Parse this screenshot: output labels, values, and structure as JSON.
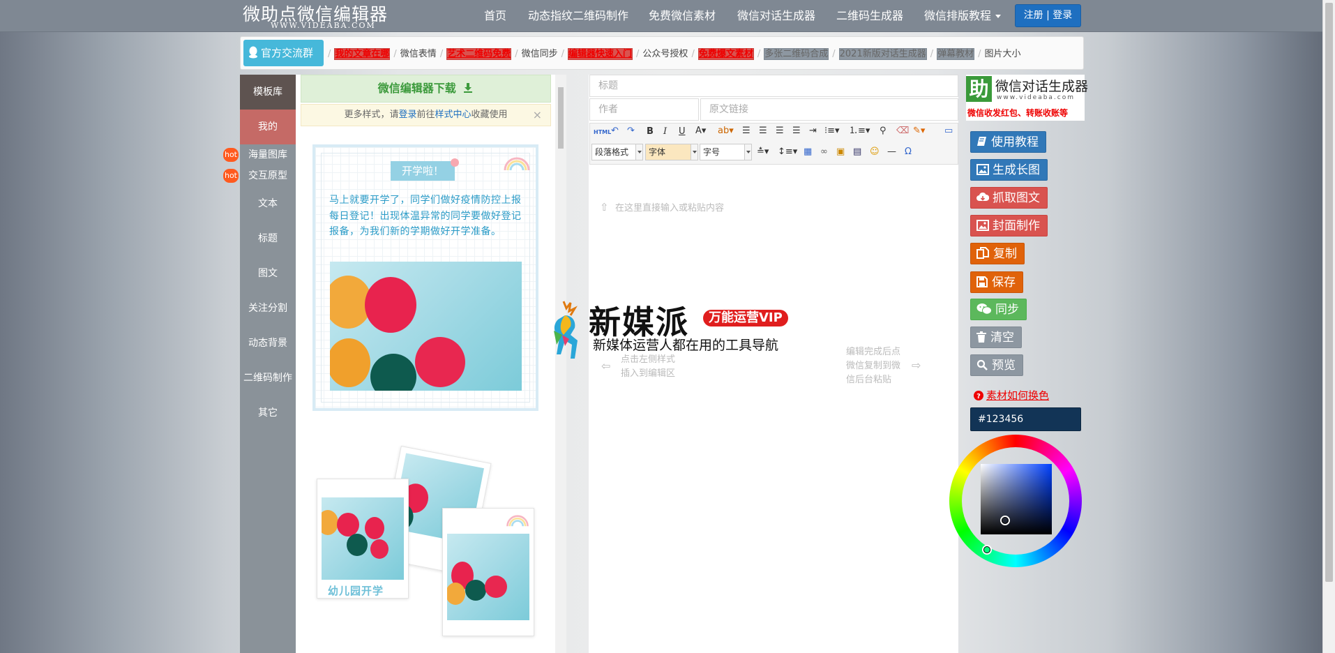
{
  "app": {
    "logo_title": "微助点微信编辑器",
    "logo_subtitle": "WWW.VIDEABA.COM",
    "nav": [
      "首页",
      "动态指纹二维码制作",
      "免费微信素材",
      "微信对话生成器",
      "二维码生成器",
      "微信排版教程"
    ],
    "login_label": "注册 | 登录"
  },
  "quickbar": {
    "group_label": "官方交流群",
    "links": [
      {
        "label": "我的文章在哪",
        "style": "red"
      },
      {
        "label": "微信表情",
        "style": "dark"
      },
      {
        "label": "艺术二维码免费",
        "style": "red"
      },
      {
        "label": "微信同步",
        "style": "dark"
      },
      {
        "label": "编辑器快速入门",
        "style": "red"
      },
      {
        "label": "公众号授权",
        "style": "dark"
      },
      {
        "label": "免费爆文素材",
        "style": "red"
      },
      {
        "label": "多张二维码合成",
        "style": "gray"
      },
      {
        "label": "2021新版对话生成器",
        "style": "gray"
      },
      {
        "label": "弹幕教材",
        "style": "gray"
      },
      {
        "label": "图片大小",
        "style": "dark"
      }
    ]
  },
  "sidebar": {
    "items": [
      "模板库",
      "我的",
      "海量图库",
      "交互原型",
      "文本",
      "标题",
      "图文",
      "关注分割",
      "动态背景",
      "二维码制作",
      "其它"
    ],
    "hot_badge": "hot"
  },
  "templates": {
    "download_label": "微信编辑器下载",
    "notice_prefix": "更多样式，请",
    "notice_login": "登录",
    "notice_mid": "前往",
    "notice_link": "样式中心",
    "notice_suffix": "收藏使用",
    "notice_close": "×",
    "card1_title": "开学啦！",
    "card1_text": "马上就要开学了，同学们做好疫情防控上报每日登记！出现体温异常的同学要做好登记报备，为我们新的学期做好开学准备。",
    "card2_caption": "幼儿园开学"
  },
  "editor": {
    "title_placeholder": "标题",
    "author_placeholder": "作者",
    "link_placeholder": "原文链接",
    "paragraph_select": "段落格式",
    "font_select": "字体",
    "size_select": "字号",
    "hint_top": "在这里直接输入或粘贴内容",
    "hint_left_1": "点击左侧样式",
    "hint_left_2": "插入到编辑区",
    "hint_right_1": "编辑完成后点",
    "hint_right_2": "微信复制到微",
    "hint_right_3": "信后台粘贴"
  },
  "watermark": {
    "brand": "新媒派",
    "badge": "万能运营VIP",
    "tagline": "新媒体运营人都在用的工具导航"
  },
  "right_panel": {
    "logo_char": "助",
    "logo_title": "微信对话生成器",
    "logo_url": "www.videaba.com",
    "logo_tag": "微信收发红包、转账收账等",
    "buttons": [
      {
        "label": "使用教程",
        "icon": "book-icon",
        "color": "blue"
      },
      {
        "label": "生成长图",
        "icon": "image-icon",
        "color": "blue"
      },
      {
        "label": "抓取图文",
        "icon": "cloud-download-icon",
        "color": "red"
      },
      {
        "label": "封面制作",
        "icon": "picture-icon",
        "color": "red"
      },
      {
        "label": "复制",
        "icon": "copy-icon",
        "color": "orange"
      },
      {
        "label": "保存",
        "icon": "save-icon",
        "color": "orange"
      },
      {
        "label": "同步",
        "icon": "wechat-icon",
        "color": "green"
      },
      {
        "label": "清空",
        "icon": "trash-icon",
        "color": "gray"
      },
      {
        "label": "预览",
        "icon": "search-icon",
        "color": "gray"
      }
    ],
    "color_help": "素材如何换色",
    "hex_value": "#123456",
    "picker_color": "#123456"
  }
}
